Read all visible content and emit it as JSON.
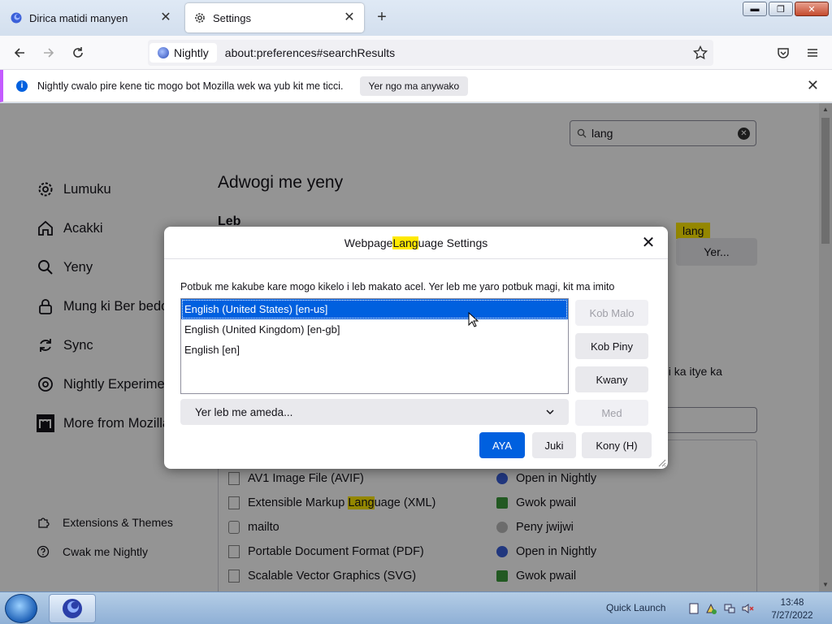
{
  "tabs": [
    {
      "label": "Dirica matidi manyen",
      "close": "✕"
    },
    {
      "label": "Settings",
      "close": "✕"
    }
  ],
  "new_tab": "+",
  "window_buttons": {
    "minimize": "▬",
    "maximize": "❐",
    "close": "✕"
  },
  "urlbar": {
    "identity": "Nightly",
    "url": "about:preferences#searchResults"
  },
  "notification": {
    "text": "Nightly cwalo pire kene tic mogo bot Mozilla wek wa yub kit me ticci.",
    "button": "Yer ngo ma anywako",
    "close": "✕"
  },
  "search": {
    "value": "lang",
    "clear": "✕"
  },
  "sidebar": {
    "items": [
      {
        "label": "Lumuku"
      },
      {
        "label": "Acakki"
      },
      {
        "label": "Yeny"
      },
      {
        "label": "Mung ki Ber bedo"
      },
      {
        "label": "Sync"
      },
      {
        "label": "Nightly Experiments"
      },
      {
        "label": "More from Mozilla"
      }
    ],
    "footer": [
      {
        "label": "Extensions & Themes"
      },
      {
        "label": "Cwak me Nightly"
      }
    ]
  },
  "content": {
    "heading": "Adwogi me yeny",
    "section": "Leb",
    "lang_highlight": "lang",
    "choose_button": "Yer...",
    "partial_text": "gi ka itye ka",
    "apps": [
      {
        "type": "AV1 Image File (AVIF)",
        "action": "Open in Nightly"
      },
      {
        "type_pre": "Extensible Markup ",
        "type_hl": "Lang",
        "type_post": "uage (XML)",
        "action": "Gwok pwail"
      },
      {
        "type": "mailto",
        "action": "Peny jwijwi"
      },
      {
        "type": "Portable Document Format (PDF)",
        "action": "Open in Nightly"
      },
      {
        "type": "Scalable Vector Graphics (SVG)",
        "action": "Gwok pwail"
      }
    ]
  },
  "dialog": {
    "title_pre": "Webpage ",
    "title_hl": "Lang",
    "title_post": "uage Settings",
    "close": "✕",
    "description": "Potbuk me kakube kare mogo kikelo i leb makato acel. Yer leb me yaro potbuk magi, kit ma imito",
    "languages": [
      {
        "label": "English (United States)  [en-us]",
        "selected": true
      },
      {
        "label": "English (United Kingdom)  [en-gb]",
        "selected": false
      },
      {
        "label": "English  [en]",
        "selected": false
      }
    ],
    "move_up": "Kob Malo",
    "move_down": "Kob Piny",
    "remove": "Kwany",
    "select_placeholder": "Yer leb me ameda...",
    "add": "Med",
    "ok": "AYA",
    "cancel": "Juki",
    "help": "Kony (H)"
  },
  "taskbar": {
    "quick_launch": "Quick Launch",
    "time": "13:48",
    "date": "7/27/2022"
  },
  "colors": {
    "accent": "#0060df",
    "highlight": "#ffe900",
    "notification_bar": "#c45bff"
  }
}
